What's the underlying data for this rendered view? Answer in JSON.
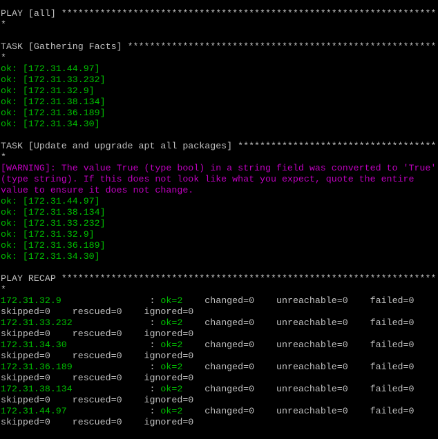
{
  "colors": {
    "background": "#000000",
    "default_text": "#c0c0c0",
    "ok": "#00c000",
    "warning": "#c000c0"
  },
  "lines": [
    {
      "kind": "header",
      "color": "white",
      "text": "PLAY [all] **********************************************************************"
    },
    {
      "kind": "header-wrap",
      "color": "white",
      "text": "*"
    },
    {
      "kind": "blank",
      "color": "white",
      "text": ""
    },
    {
      "kind": "header",
      "color": "white",
      "text": "TASK [Gathering Facts] **********************************************************"
    },
    {
      "kind": "header-wrap",
      "color": "white",
      "text": "*"
    },
    {
      "kind": "ok",
      "color": "green",
      "text": "ok: [172.31.44.97]"
    },
    {
      "kind": "ok",
      "color": "green",
      "text": "ok: [172.31.33.232]"
    },
    {
      "kind": "ok",
      "color": "green",
      "text": "ok: [172.31.32.9]"
    },
    {
      "kind": "ok",
      "color": "green",
      "text": "ok: [172.31.38.134]"
    },
    {
      "kind": "ok",
      "color": "green",
      "text": "ok: [172.31.36.189]"
    },
    {
      "kind": "ok",
      "color": "green",
      "text": "ok: [172.31.34.30]"
    },
    {
      "kind": "blank",
      "color": "white",
      "text": ""
    },
    {
      "kind": "header",
      "color": "white",
      "text": "TASK [Update and upgrade apt all packages] **************************************"
    },
    {
      "kind": "header-wrap",
      "color": "white",
      "text": "*"
    },
    {
      "kind": "warning",
      "color": "magenta",
      "text": "[WARNING]: The value True (type bool) in a string field was converted to 'True'"
    },
    {
      "kind": "warning",
      "color": "magenta",
      "text": "(type string). If this does not look like what you expect, quote the entire"
    },
    {
      "kind": "warning",
      "color": "magenta",
      "text": "value to ensure it does not change."
    },
    {
      "kind": "ok",
      "color": "green",
      "text": "ok: [172.31.44.97]"
    },
    {
      "kind": "ok",
      "color": "green",
      "text": "ok: [172.31.38.134]"
    },
    {
      "kind": "ok",
      "color": "green",
      "text": "ok: [172.31.33.232]"
    },
    {
      "kind": "ok",
      "color": "green",
      "text": "ok: [172.31.32.9]"
    },
    {
      "kind": "ok",
      "color": "green",
      "text": "ok: [172.31.36.189]"
    },
    {
      "kind": "ok",
      "color": "green",
      "text": "ok: [172.31.34.30]"
    },
    {
      "kind": "blank",
      "color": "white",
      "text": ""
    },
    {
      "kind": "header",
      "color": "white",
      "text": "PLAY RECAP **********************************************************************"
    },
    {
      "kind": "header-wrap",
      "color": "white",
      "text": "*"
    }
  ],
  "recap": [
    {
      "host": "172.31.32.9",
      "ok": "ok=2",
      "changed": "changed=0",
      "unreachable": "unreachable=0",
      "failed": "failed=0",
      "skipped": "skipped=0",
      "rescued": "rescued=0",
      "ignored": "ignored=0"
    },
    {
      "host": "172.31.33.232",
      "ok": "ok=2",
      "changed": "changed=0",
      "unreachable": "unreachable=0",
      "failed": "failed=0",
      "skipped": "skipped=0",
      "rescued": "rescued=0",
      "ignored": "ignored=0"
    },
    {
      "host": "172.31.34.30",
      "ok": "ok=2",
      "changed": "changed=0",
      "unreachable": "unreachable=0",
      "failed": "failed=0",
      "skipped": "skipped=0",
      "rescued": "rescued=0",
      "ignored": "ignored=0"
    },
    {
      "host": "172.31.36.189",
      "ok": "ok=2",
      "changed": "changed=0",
      "unreachable": "unreachable=0",
      "failed": "failed=0",
      "skipped": "skipped=0",
      "rescued": "rescued=0",
      "ignored": "ignored=0"
    },
    {
      "host": "172.31.38.134",
      "ok": "ok=2",
      "changed": "changed=0",
      "unreachable": "unreachable=0",
      "failed": "failed=0",
      "skipped": "skipped=0",
      "rescued": "rescued=0",
      "ignored": "ignored=0"
    },
    {
      "host": "172.31.44.97",
      "ok": "ok=2",
      "changed": "changed=0",
      "unreachable": "unreachable=0",
      "failed": "failed=0",
      "skipped": "skipped=0",
      "rescued": "rescued=0",
      "ignored": "ignored=0"
    }
  ]
}
